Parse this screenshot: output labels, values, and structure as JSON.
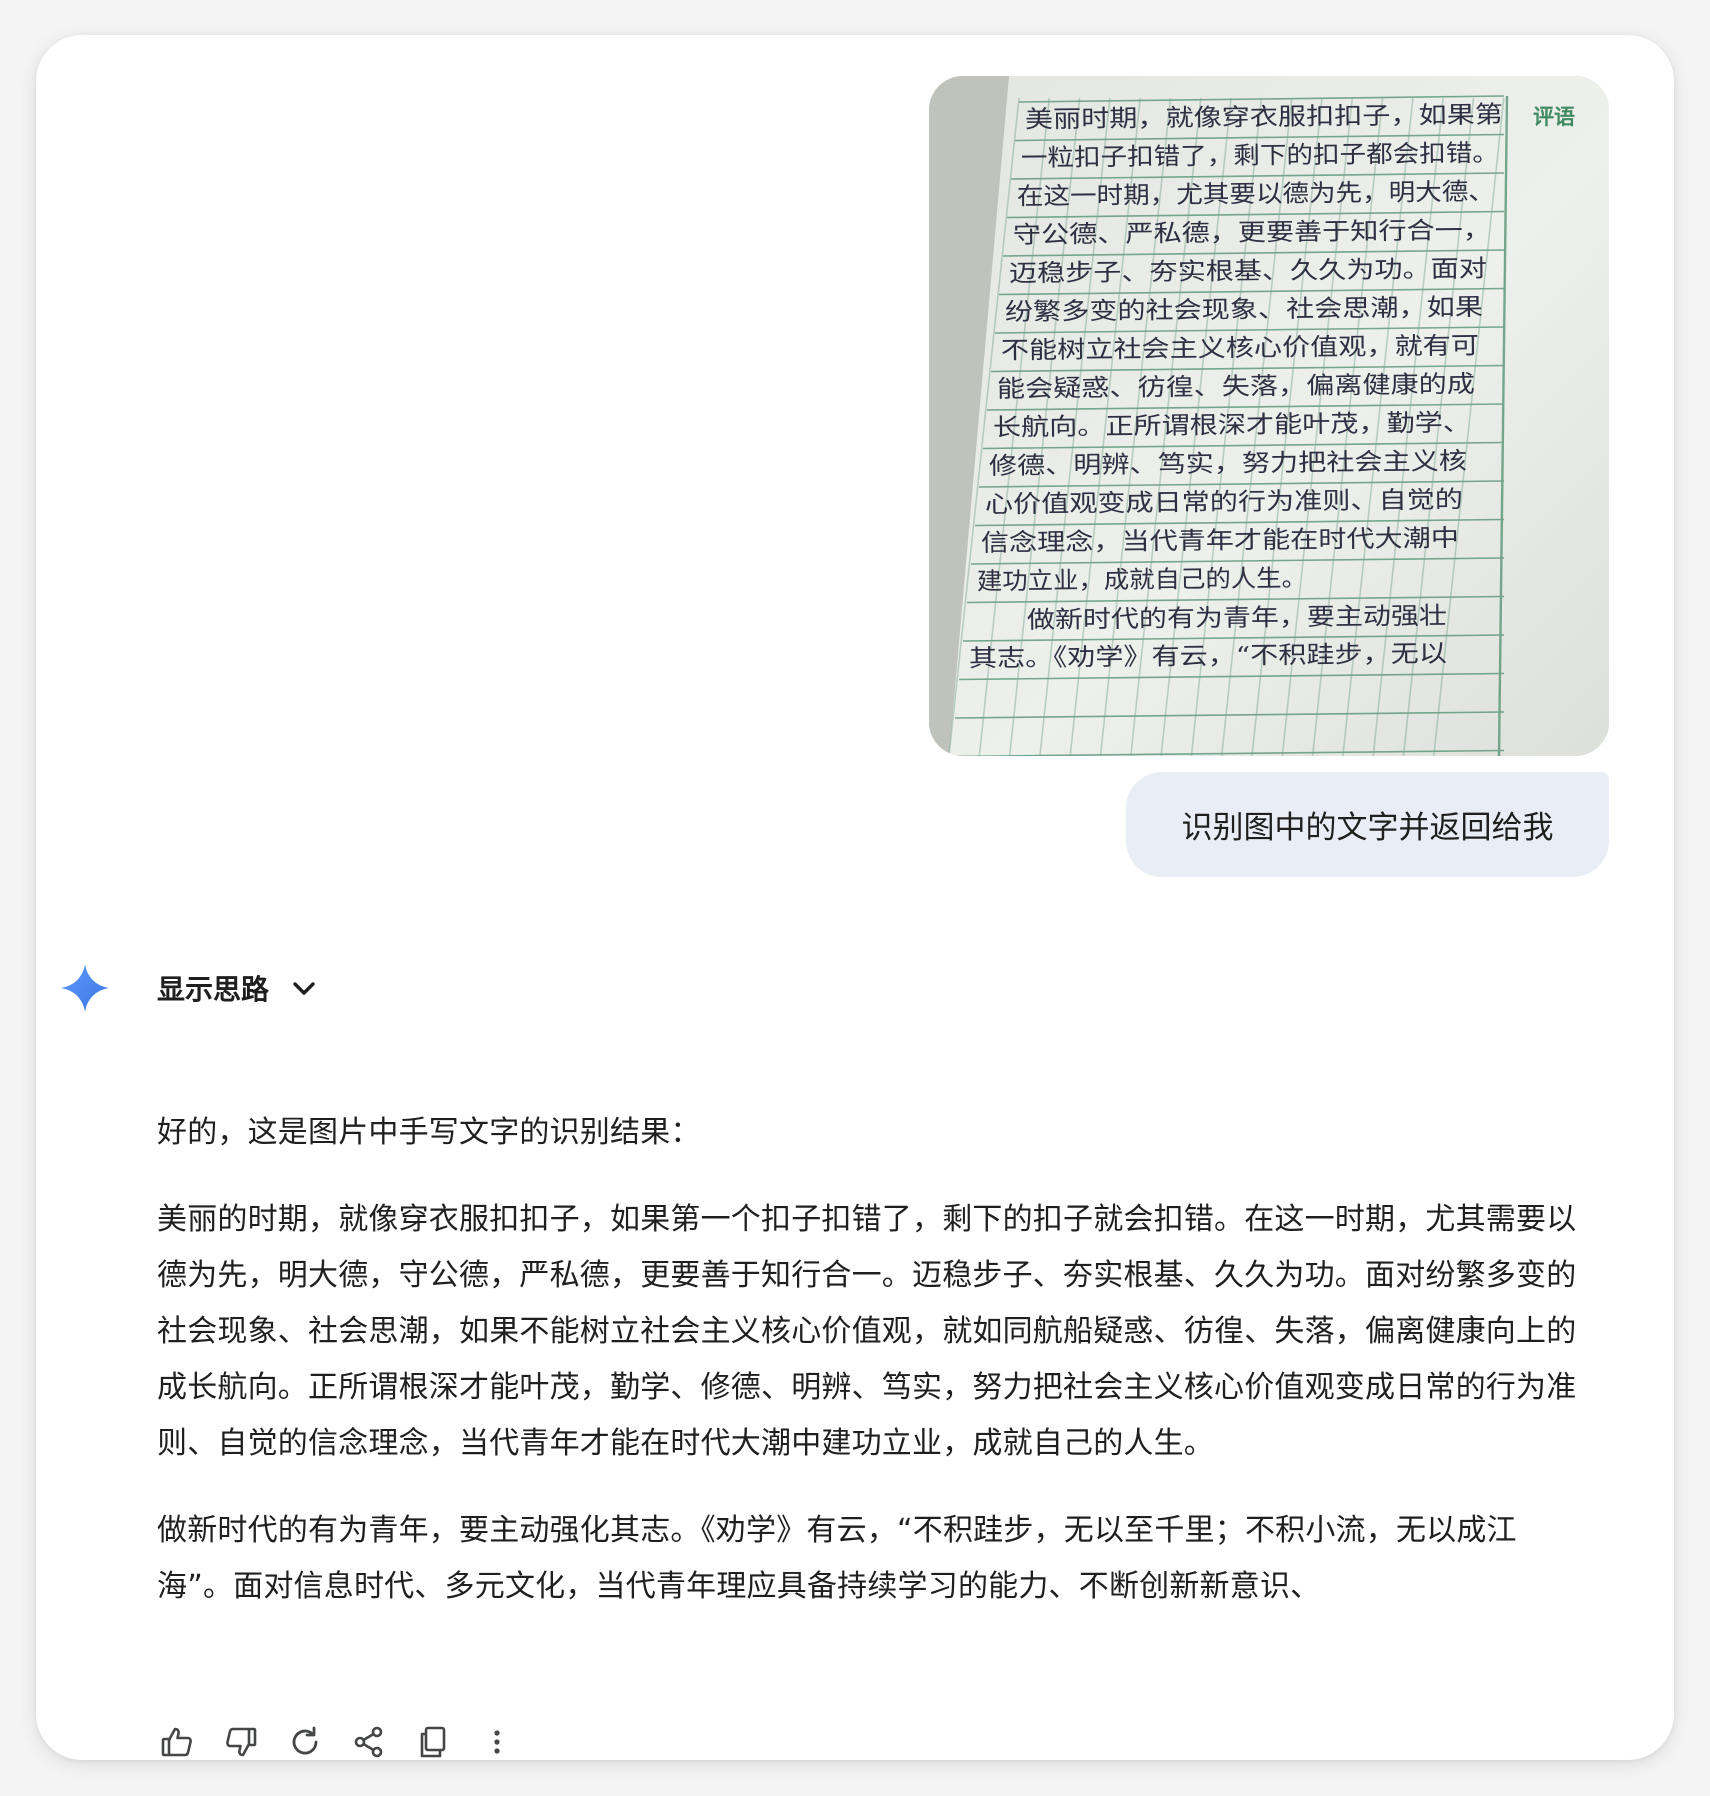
{
  "user_message": {
    "image": {
      "description_icon": "handwritten-essay-photo",
      "sidebar_label": "评语",
      "handwritten_lines": [
        "美丽时期，就像穿衣服扣扣子，如果第",
        "一粒扣子扣错了，剩下的扣子都会扣错。",
        "在这一时期，尤其要以德为先，明大德、",
        "守公德、严私德，更要善于知行合一，",
        "迈稳步子、夯实根基、久久为功。面对",
        "纷繁多变的社会现象、社会思潮，如果",
        "不能树立社会主义核心价值观，就有可",
        "能会疑惑、彷徨、失落，偏离健康的成",
        "长航向。正所谓根深才能叶茂，勤学、",
        "修德、明辨、笃实，努力把社会主义核",
        "心价值观变成日常的行为准则、自觉的",
        "信念理念，当代青年才能在时代大潮中",
        "建功立业，成就自己的人生。",
        "做新时代的有为青年，要主动强壮",
        "其志。《劝学》有云，“不积跬步，无以"
      ]
    },
    "text": "识别图中的文字并返回给我"
  },
  "response": {
    "show_thoughts_label": "显示思路",
    "intro": "好的，这是图片中手写文字的识别结果：",
    "paragraphs": [
      "美丽的时期，就像穿衣服扣扣子，如果第一个扣子扣错了，剩下的扣子就会扣错。在这一时期，尤其需要以德为先，明大德，守公德，严私德，更要善于知行合一。迈稳步子、夯实根基、久久为功。面对纷繁多变的社会现象、社会思潮，如果不能树立社会主义核心价值观，就如同航船疑惑、彷徨、失落，偏离健康向上的成长航向。正所谓根深才能叶茂，勤学、修德、明辨、笃实，努力把社会主义核心价值观变成日常的行为准则、自觉的信念理念，当代青年才能在时代大潮中建功立业，成就自己的人生。",
      "做新时代的有为青年，要主动强化其志。《劝学》有云，“不积跬步，无以至千里；不积小流，无以成江海”。面对信息时代、多元文化，当代青年理应具备持续学习的能力、不断创新新意识、"
    ],
    "actions": [
      {
        "icon": "thumbs-up-icon"
      },
      {
        "icon": "thumbs-down-icon"
      },
      {
        "icon": "regenerate-icon"
      },
      {
        "icon": "share-icon"
      },
      {
        "icon": "copy-icon"
      },
      {
        "icon": "more-options-icon"
      }
    ]
  },
  "colors": {
    "accent_spark": "#4c8df6",
    "user_bubble": "#e9eef6",
    "paper_grid": "#4a8a6a",
    "ink": "#2b2b3a"
  }
}
